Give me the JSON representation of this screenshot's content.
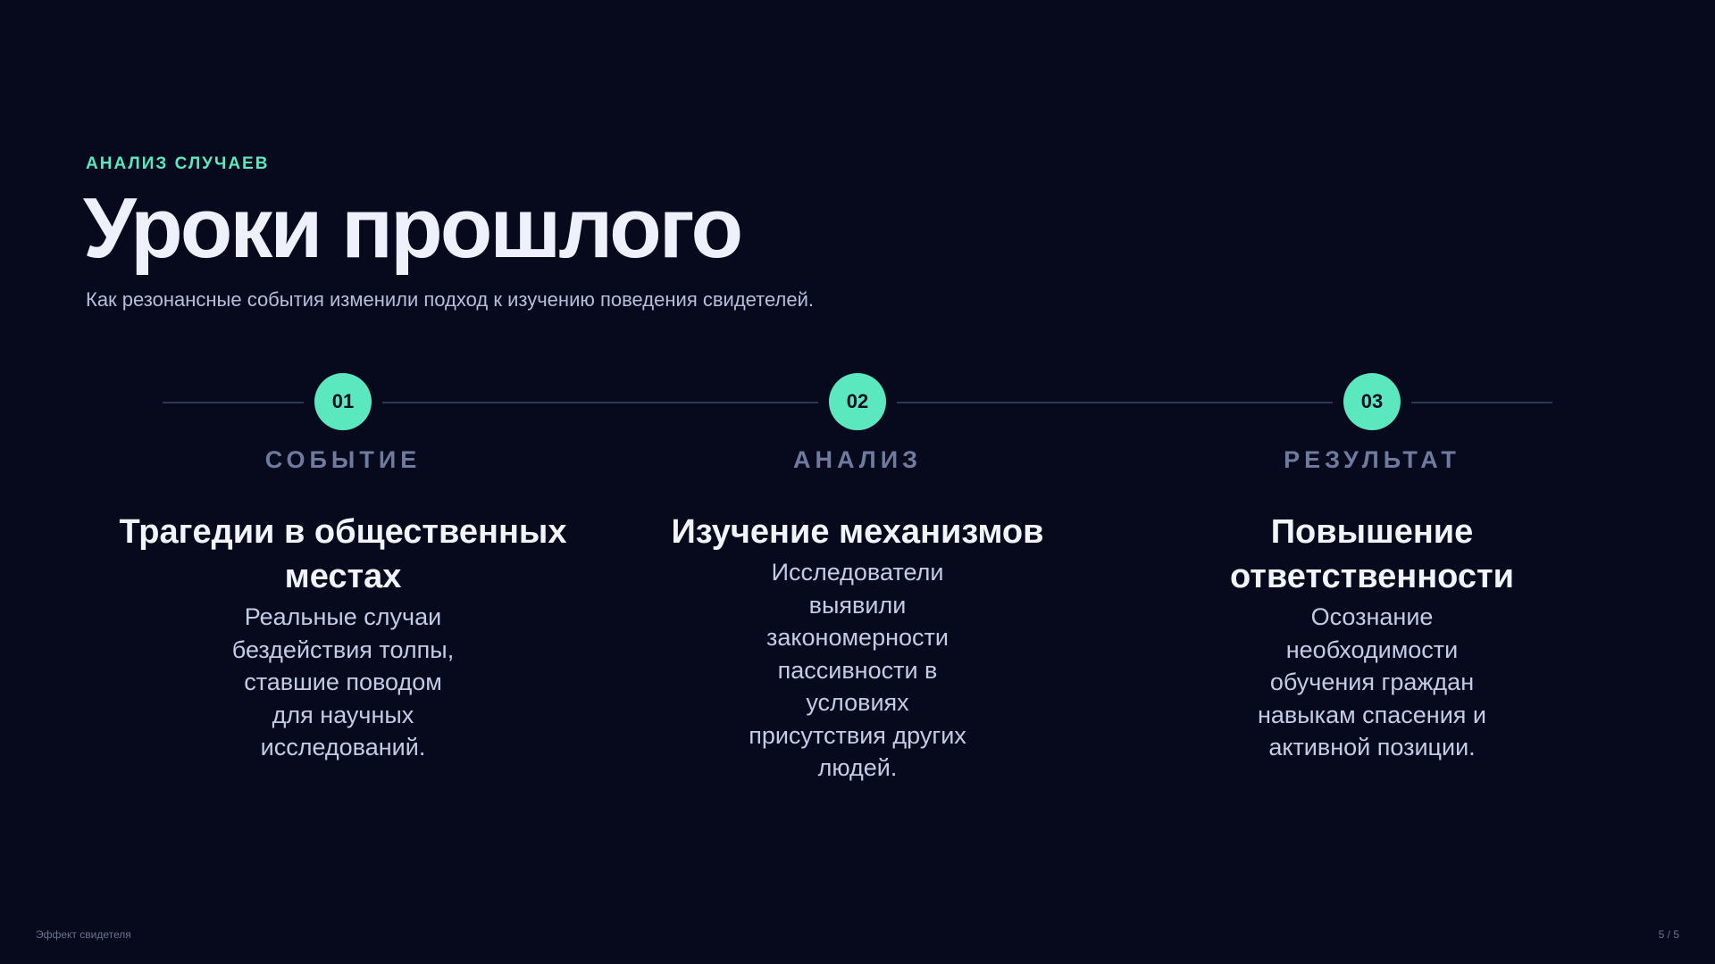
{
  "header": {
    "eyebrow": "АНАЛИЗ СЛУЧАЕВ",
    "title": "Уроки прошлого",
    "subtitle": "Как резонансные события изменили подход к изучению поведения свидетелей."
  },
  "steps": [
    {
      "number": "01",
      "label": "СОБЫТИЕ",
      "heading": "Трагедии в общественных местах",
      "body": "Реальные случаи бездействия толпы, ставшие поводом для научных исследований."
    },
    {
      "number": "02",
      "label": "АНАЛИЗ",
      "heading": "Изучение механизмов",
      "body": "Исследователи выявили закономерности пассивности в условиях присутствия других людей."
    },
    {
      "number": "03",
      "label": "РЕЗУЛЬТАТ",
      "heading": "Повышение ответственности",
      "body": "Осознание необходимости обучения граждан навыкам спасения и активной позиции."
    }
  ],
  "footer": {
    "deck_title": "Эффект свидетеля",
    "page_indicator": "5 / 5"
  },
  "colors": {
    "background": "#060a1c",
    "accent": "#5be8bf",
    "label": "#6f7b9e",
    "timeline": "#2a3a52"
  }
}
